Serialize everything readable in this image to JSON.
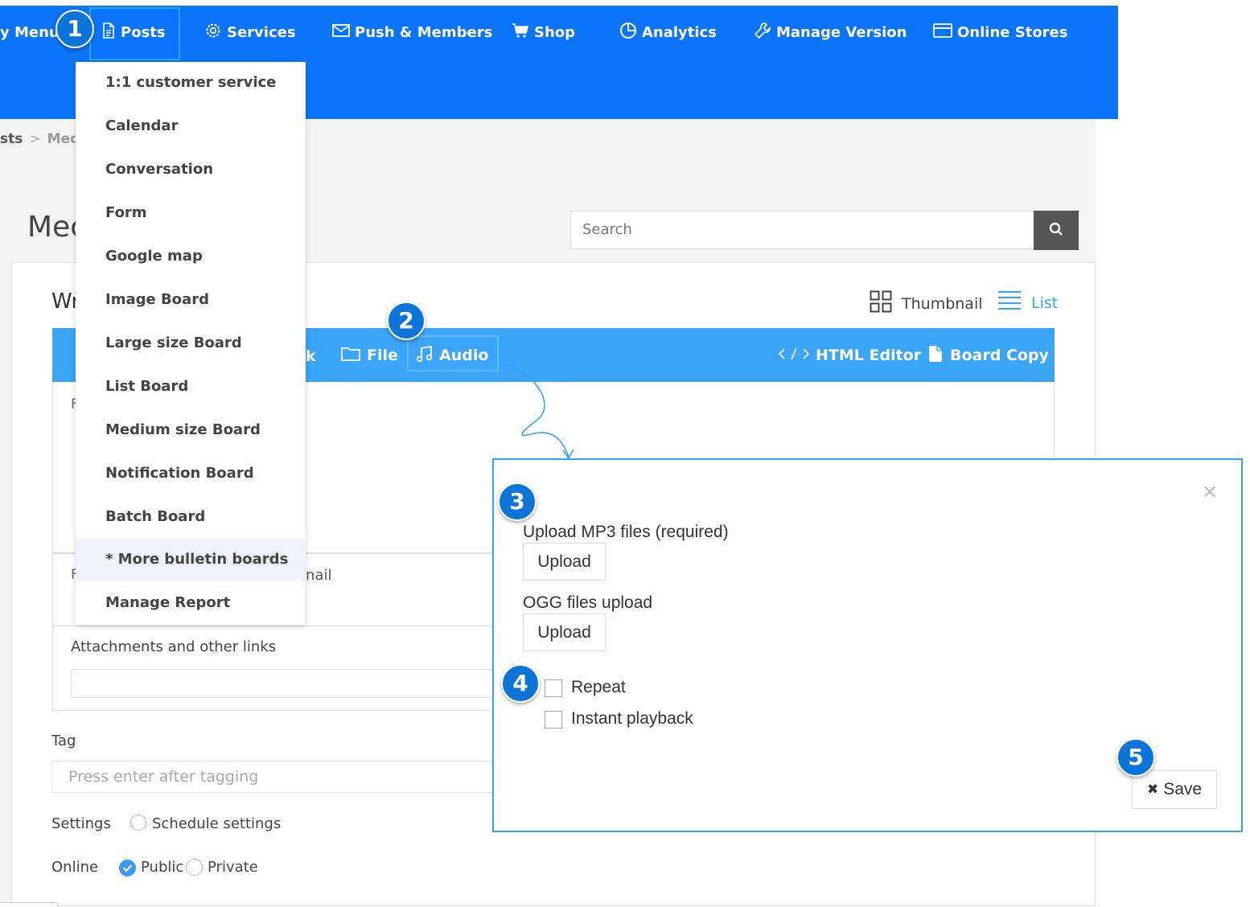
{
  "nav": {
    "my_menu": "y Menu",
    "posts": "Posts",
    "services": "Services",
    "push_members": "Push & Members",
    "shop": "Shop",
    "analytics": "Analytics",
    "manage_version": "Manage Version",
    "online_stores": "Online Stores"
  },
  "breadcrumb": {
    "first": "sts",
    "sep": ">",
    "second": "Med"
  },
  "page": {
    "title": "Mec",
    "section_title": "Wr"
  },
  "search": {
    "placeholder": "Search"
  },
  "view": {
    "thumbnail": "Thumbnail",
    "list": "List"
  },
  "toolbar": {
    "link_fragment": "k",
    "file": "File",
    "audio": "Audio",
    "html_editor": "HTML Editor",
    "board_copy": "Board Copy"
  },
  "form": {
    "p1": "F",
    "p2": "F",
    "thumbnail_fragment": "nail",
    "attachments_label": "Attachments and other links",
    "tag_label": "Tag",
    "tag_placeholder": "Press enter after tagging",
    "settings_label": "Settings",
    "schedule_label": "Schedule settings",
    "online_label": "Online",
    "public_label": "Public",
    "private_label": "Private"
  },
  "dropdown": {
    "items": [
      "1:1 customer service",
      "Calendar",
      "Conversation",
      "Form",
      "Google map",
      "Image Board",
      "Large size Board",
      "List Board",
      "Medium size Board",
      "Notification Board",
      "Batch Board",
      "* More bulletin boards",
      "Manage Report"
    ]
  },
  "modal": {
    "close": "×",
    "mp3_label": "Upload MP3 files (required)",
    "upload_1": "Upload",
    "ogg_label": "OGG files upload",
    "upload_2": "Upload",
    "repeat_label": "Repeat",
    "instant_label": "Instant playback",
    "save_icon": "✖",
    "save_label": "Save"
  },
  "badges": [
    "1",
    "2",
    "3",
    "4",
    "5"
  ],
  "colors": {
    "nav_blue": "#0a74fb",
    "toolbar_blue": "#3ba5f7",
    "badge_blue": "#0a74d8",
    "highlight_border": "#33a1ff",
    "search_button": "#555555"
  },
  "icons": {
    "posts": "document-icon",
    "services": "gear-icon",
    "push_members": "envelope-icon",
    "shop": "cart-icon",
    "analytics": "pie-chart-icon",
    "manage_version": "wrench-icon",
    "online_stores": "card-icon",
    "search": "search-icon",
    "thumbnail": "grid-icon",
    "list": "list-icon",
    "file": "folder-icon",
    "audio": "music-note-icon",
    "html_editor": "code-icon",
    "board_copy": "copy-icon",
    "save": "x-mark-icon",
    "close": "close-icon"
  }
}
